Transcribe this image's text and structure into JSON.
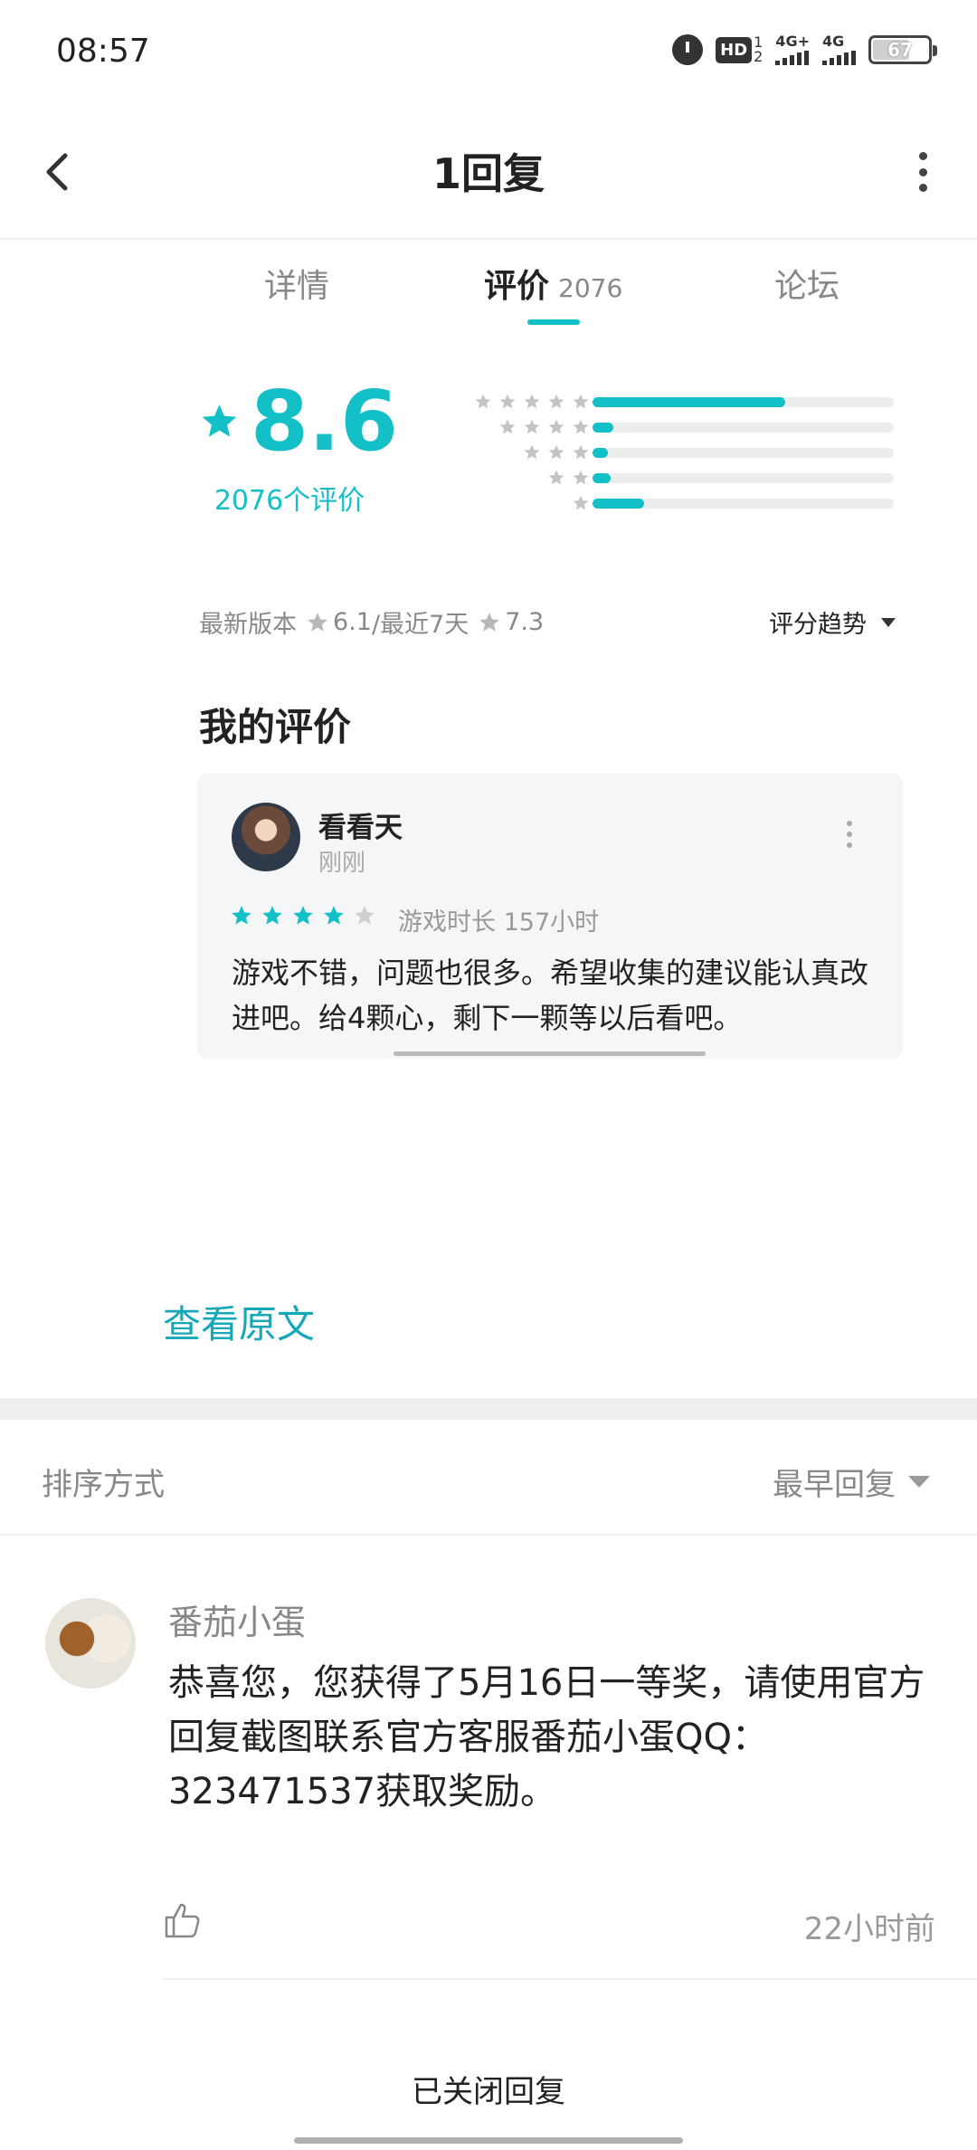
{
  "status_bar": {
    "time": "08:57",
    "hd_label": "HD",
    "hd_sup": "1",
    "hd_sub": "2",
    "net1_label": "4G+",
    "net2_label": "4G",
    "battery": "67"
  },
  "header": {
    "title": "1回复"
  },
  "tabs": [
    {
      "label": "详情"
    },
    {
      "label": "评价",
      "count": "2076"
    },
    {
      "label": "论坛"
    }
  ],
  "rating": {
    "score": "8.6",
    "count_text": "2076个评价",
    "distribution": [
      0.64,
      0.07,
      0.05,
      0.06,
      0.17
    ],
    "accent_color": "#14c0c8"
  },
  "version_row": {
    "latest_label": "最新版本",
    "latest_score": "6.1",
    "separator": "/最近7天",
    "recent_score": "7.3",
    "trend_label": "评分趋势"
  },
  "my_review": {
    "title": "我的评价",
    "user_name": "看看天",
    "time": "刚刚",
    "stars": 4,
    "playtime": "游戏时长 157小时",
    "content": "游戏不错，问题也很多。希望收集的建议能认真改进吧。给4颗心，剩下一颗等以后看吧。"
  },
  "view_original": "查看原文",
  "sort": {
    "label": "排序方式",
    "value": "最早回复"
  },
  "reply": {
    "user_name": "番茄小蛋",
    "content": "恭喜您，您获得了5月16日一等奖，请使用官方回复截图联系官方客服番茄小蛋QQ：323471537获取奖励。",
    "time": "22小时前"
  },
  "footer": {
    "closed_text": "已关闭回复"
  }
}
